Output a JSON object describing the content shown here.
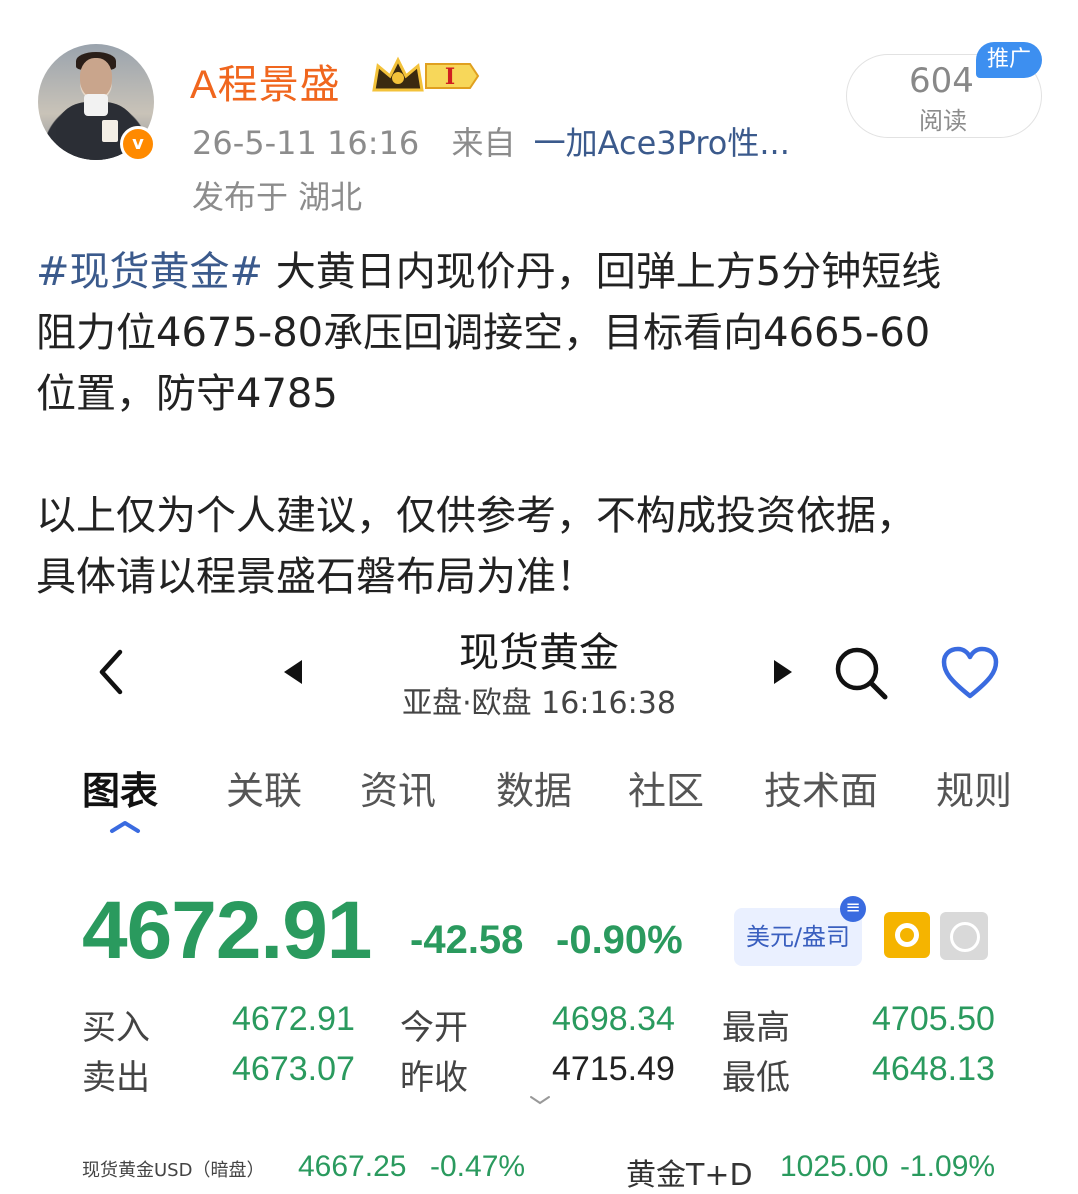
{
  "post": {
    "username": "A程景盛",
    "verified_badge": "v",
    "level_badge": "I",
    "timestamp": "26-5-11 16:16",
    "source_prefix": "来自",
    "device": "一加Ace3Pro性...",
    "location": "发布于 湖北",
    "read_count": "604",
    "read_label": "阅读",
    "ad_tag": "推广",
    "hashtag": "#现货黄金#",
    "body_line1": " 大黄日内现价丹，回弹上方5分钟短线",
    "body_line2": "阻力位4675-80承压回调接空，目标看向4665-60",
    "body_line3": "位置，防守4785",
    "body_line4": "以上仅为个人建议，仅供参考，不构成投资依据，",
    "body_line5": "具体请以程景盛石磐布局为准！"
  },
  "quote": {
    "title": "现货黄金",
    "subtitle": "亚盘·欧盘  16:16:38",
    "tabs": [
      "图表",
      "关联",
      "资讯",
      "数据",
      "社区",
      "技术面",
      "规则"
    ],
    "active_tab": "图表",
    "price": "4672.91",
    "change": "-42.58",
    "change_pct": "-0.90%",
    "unit": "美元/盎司",
    "unit_badge": "≡",
    "stats": {
      "buy_label": "买入",
      "buy": "4672.91",
      "sell_label": "卖出",
      "sell": "4673.07",
      "open_label": "今开",
      "open": "4698.34",
      "prev_close_label": "昨收",
      "prev_close": "4715.49",
      "high_label": "最高",
      "high": "4705.50",
      "low_label": "最低",
      "low": "4648.13"
    },
    "related": [
      {
        "name": "现货黄金USD（暗盘）",
        "price": "4667.25",
        "pct": "-0.47%"
      },
      {
        "name": "黄金T+D",
        "price": "1025.00",
        "pct": "-1.09%"
      }
    ],
    "colors": {
      "down": "#2a9a5e",
      "accent": "#3a6be0",
      "username": "#f0661e",
      "link": "#3b5a8c"
    }
  }
}
